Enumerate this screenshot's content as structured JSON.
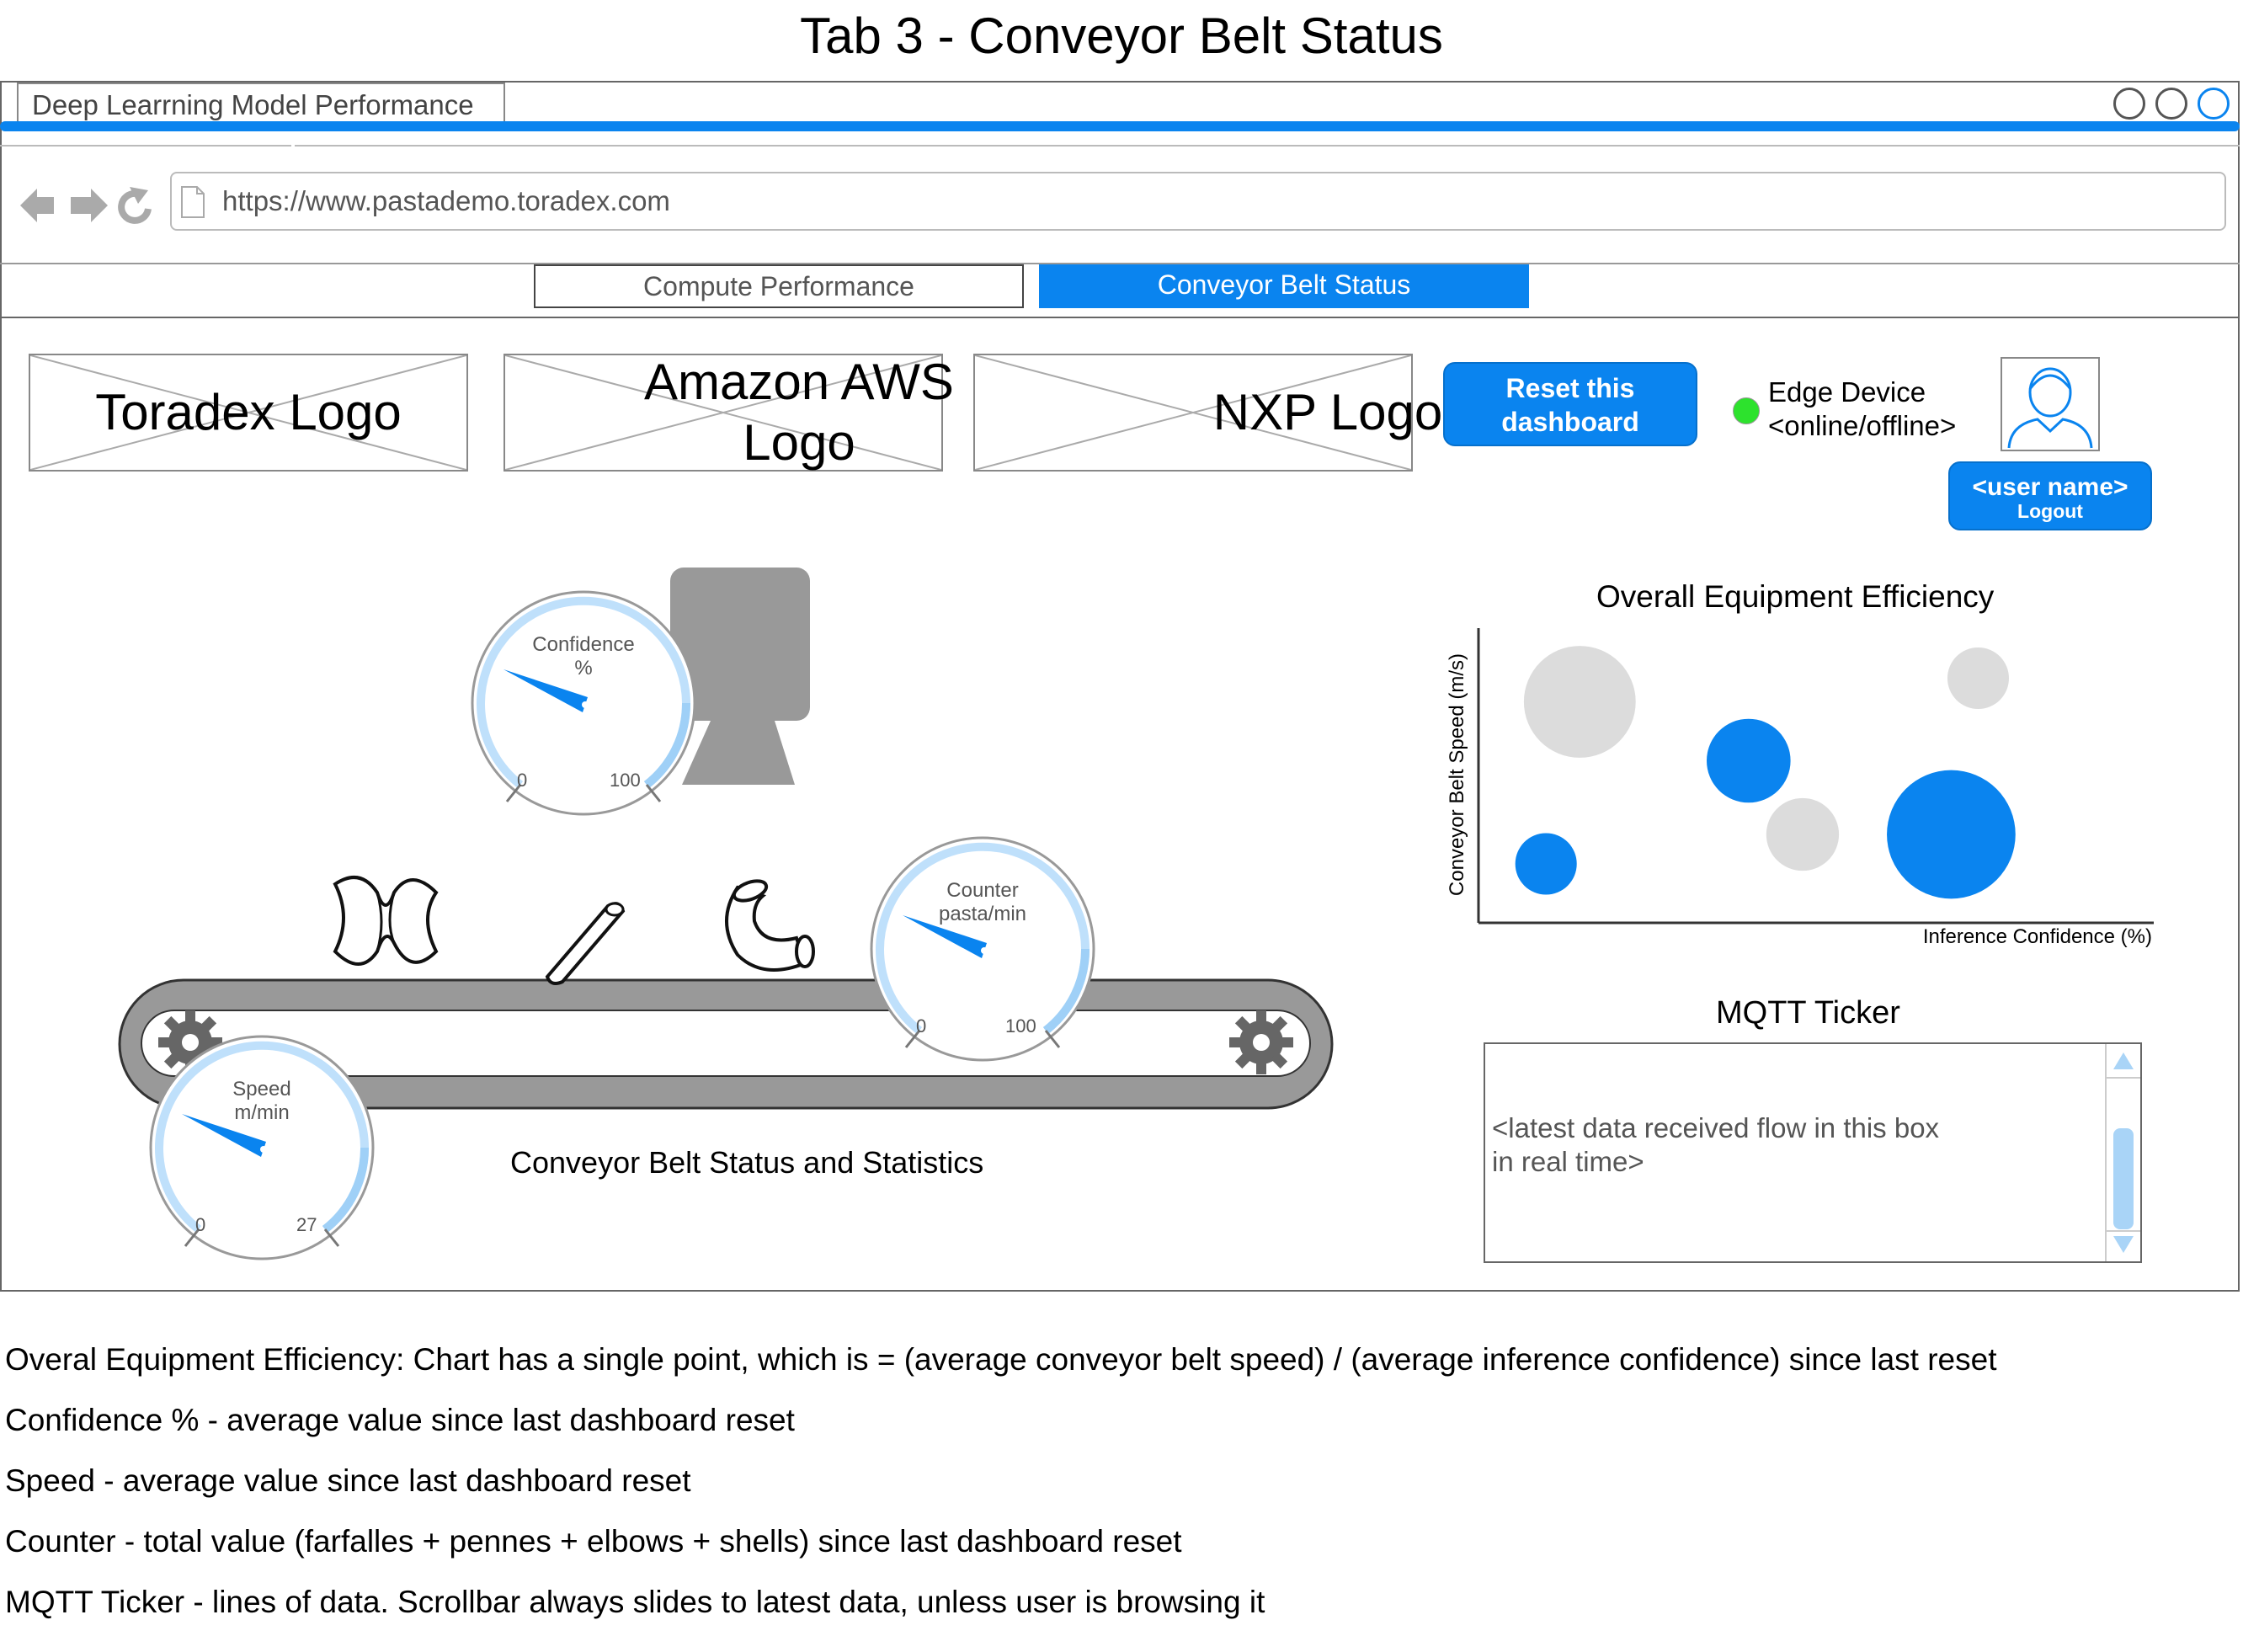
{
  "page_title": "Tab 3 - Conveyor Belt Status",
  "browser": {
    "tab_title": "Deep Learrning Model Performance",
    "url": "https://www.pastademo.toradex.com",
    "accent_color": "#0a84ef"
  },
  "nav_tabs": [
    {
      "label": "Compute Performance",
      "active": false
    },
    {
      "label": "Conveyor Belt Status",
      "active": true
    }
  ],
  "logos": [
    {
      "label": "Toradex Logo"
    },
    {
      "label": "Amazon AWS Logo"
    },
    {
      "label": "NXP Logo"
    }
  ],
  "header": {
    "reset_button": "Reset this dashboard",
    "edge_device_line1": "Edge Device",
    "edge_device_line2": "<online/offline>",
    "status_color": "#2de22d",
    "user_name": "<user name>",
    "logout": "Logout"
  },
  "gauges": {
    "confidence": {
      "label_line1": "Confidence",
      "label_line2": "%",
      "min": "0",
      "max": "100"
    },
    "counter": {
      "label_line1": "Counter",
      "label_line2": "pasta/min",
      "min": "0",
      "max": "100"
    },
    "speed": {
      "label_line1": "Speed",
      "label_line2": "m/min",
      "min": "0",
      "max": "27"
    }
  },
  "belt_caption": "Conveyor Belt Status and Statistics",
  "chart_data": {
    "type": "scatter",
    "title": "Overall Equipment Efficiency",
    "xlabel": "Inference Confidence (%)",
    "ylabel": "Conveyor Belt Speed (m/s)",
    "xlim": [
      0,
      100
    ],
    "ylim": [
      0,
      100
    ],
    "grid": false,
    "points": [
      {
        "x": 15,
        "y": 75,
        "size": 40,
        "color": "#dcdcdc"
      },
      {
        "x": 40,
        "y": 55,
        "size": 30,
        "color": "#0a84ef"
      },
      {
        "x": 48,
        "y": 30,
        "size": 26,
        "color": "#dcdcdc"
      },
      {
        "x": 74,
        "y": 83,
        "size": 22,
        "color": "#dcdcdc"
      },
      {
        "x": 70,
        "y": 30,
        "size": 46,
        "color": "#0a84ef"
      },
      {
        "x": 10,
        "y": 20,
        "size": 22,
        "color": "#0a84ef"
      }
    ]
  },
  "mqtt": {
    "title": "MQTT Ticker",
    "placeholder_line1": "<latest data received flow in this box",
    "placeholder_line2": "in real time>"
  },
  "notes": [
    "Overal Equipment Efficiency: Chart has a single point, which is = (average conveyor belt speed) / (average inference confidence) since last reset",
    "Confidence % - average value since last dashboard reset",
    "Speed - average value since last dashboard reset",
    "Counter - total value (farfalles + pennes + elbows + shells) since last dashboard reset",
    "MQTT Ticker - lines of data. Scrollbar always slides to latest data, unless user is browsing it"
  ]
}
